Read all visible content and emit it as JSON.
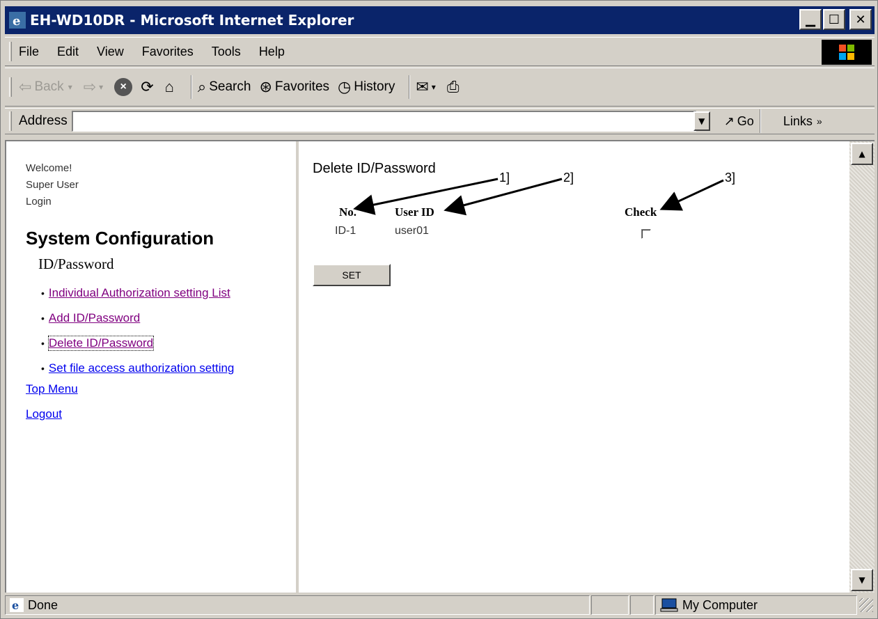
{
  "window": {
    "title": "EH-WD10DR - Microsoft Internet Explorer"
  },
  "menubar": {
    "items": [
      "File",
      "Edit",
      "View",
      "Favorites",
      "Tools",
      "Help"
    ]
  },
  "toolbar": {
    "back": "Back",
    "search": "Search",
    "favorites": "Favorites",
    "history": "History"
  },
  "addressbar": {
    "label": "Address",
    "value": "",
    "go": "Go",
    "links": "Links"
  },
  "left_nav": {
    "welcome": "Welcome!",
    "user": "Super User",
    "login": "Login",
    "system_title": "System Configuration",
    "section": "ID/Password",
    "items": [
      {
        "label": "Individual Authorization setting List",
        "state": "visited"
      },
      {
        "label": "Add ID/Password",
        "state": "visited"
      },
      {
        "label": "Delete ID/Password",
        "state": "current"
      },
      {
        "label": "Set file access authorization setting",
        "state": "link"
      }
    ],
    "top_menu": "Top Menu",
    "logout": "Logout"
  },
  "main": {
    "title": "Delete ID/Password",
    "columns": {
      "no": "No.",
      "user_id": "User ID",
      "check": "Check"
    },
    "rows": [
      {
        "no": "ID-1",
        "user_id": "user01",
        "checked": false
      }
    ],
    "set_button": "SET",
    "callouts": [
      "1]",
      "2]",
      "3]"
    ]
  },
  "statusbar": {
    "text": "Done",
    "zone": "My Computer"
  }
}
